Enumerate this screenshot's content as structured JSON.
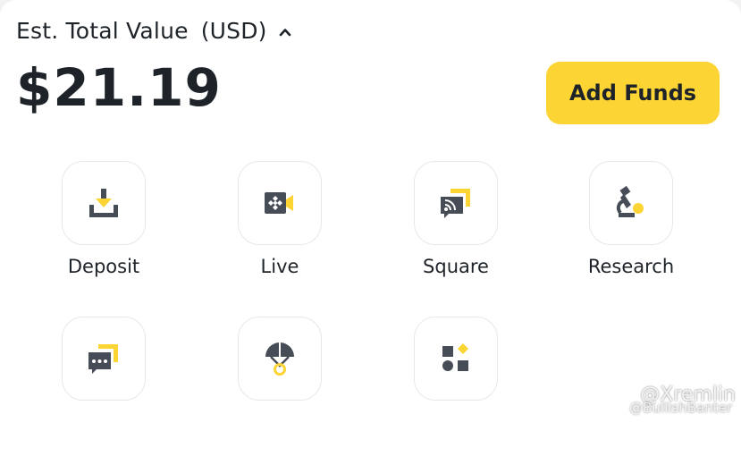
{
  "balance_header": {
    "label": "Est. Total Value",
    "currency": "(USD)",
    "caret_icon": "chevron-up-icon",
    "amount": "$21.19",
    "add_funds_label": "Add Funds"
  },
  "colors": {
    "accent": "#fcd535",
    "icon_dark": "#474d57",
    "text": "#1e2329",
    "tile_border": "#e6e8ea"
  },
  "shortcuts": [
    {
      "label": "Deposit",
      "icon": "deposit-icon"
    },
    {
      "label": "Live",
      "icon": "live-camera-icon"
    },
    {
      "label": "Square",
      "icon": "square-feed-icon"
    },
    {
      "label": "Research",
      "icon": "microscope-icon"
    },
    {
      "label": "",
      "icon": "chat-icon"
    },
    {
      "label": "",
      "icon": "parachute-icon"
    },
    {
      "label": "",
      "icon": "more-shapes-icon"
    }
  ],
  "watermark": {
    "handle": "@Xremlin",
    "sub": "@BullishBanter"
  }
}
